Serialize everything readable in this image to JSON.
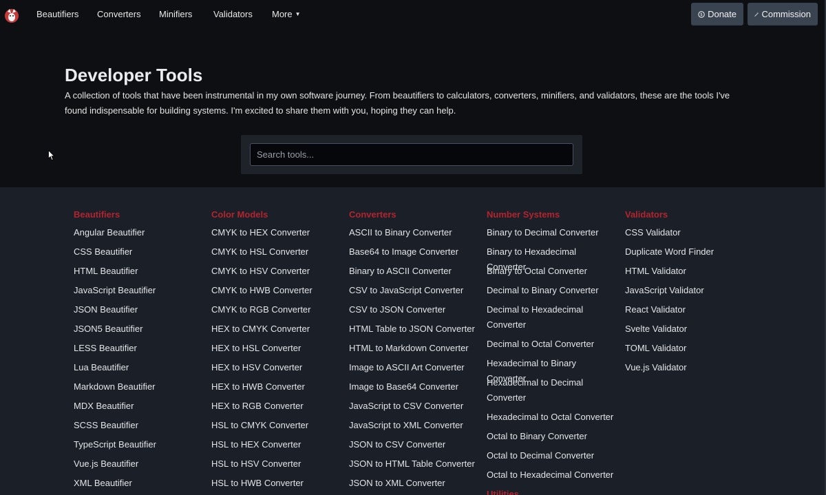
{
  "nav": {
    "items": [
      "Beautifiers",
      "Converters",
      "Minifiers",
      "Validators",
      "More"
    ],
    "donate_label": "Donate",
    "commission_label": "Commission",
    "logo_icon": "fox-logo-icon",
    "donate_icon": "coin-icon",
    "commission_icon": "magic-wand-icon"
  },
  "hero": {
    "title": "Developer Tools",
    "description": "A collection of tools that have been instrumental in my own software journey. From beautifiers to calculators, converters, minifiers, and validators, these are the tools I've found indispensable for building systems. I'm excited to share them with you, hoping they can help.",
    "search_placeholder": "Search tools..."
  },
  "colors": {
    "accent": "#b3242f",
    "background": "#1b1f27",
    "header_background": "#0e0f12",
    "button": "#3a4350"
  },
  "categories": [
    {
      "name": "Beautifiers",
      "items": [
        "Angular Beautifier",
        "CSS Beautifier",
        "HTML Beautifier",
        "JavaScript Beautifier",
        "JSON Beautifier",
        "JSON5 Beautifier",
        "LESS Beautifier",
        "Lua Beautifier",
        "Markdown Beautifier",
        "MDX Beautifier",
        "SCSS Beautifier",
        "TypeScript Beautifier",
        "Vue.js Beautifier",
        "XML Beautifier"
      ]
    },
    {
      "name": "Color Models",
      "items": [
        "CMYK to HEX Converter",
        "CMYK to HSL Converter",
        "CMYK to HSV Converter",
        "CMYK to HWB Converter",
        "CMYK to RGB Converter",
        "HEX to CMYK Converter",
        "HEX to HSL Converter",
        "HEX to HSV Converter",
        "HEX to HWB Converter",
        "HEX to RGB Converter",
        "HSL to CMYK Converter",
        "HSL to HEX Converter",
        "HSL to HSV Converter",
        "HSL to HWB Converter"
      ]
    },
    {
      "name": "Converters",
      "items": [
        "ASCII to Binary Converter",
        "Base64 to Image Converter",
        "Binary to ASCII Converter",
        "CSV to JavaScript Converter",
        "CSV to JSON Converter",
        "HTML Table to JSON Converter",
        "HTML to Markdown Converter",
        "Image to ASCII Art Converter",
        "Image to Base64 Converter",
        "JavaScript to CSV Converter",
        "JavaScript to XML Converter",
        "JSON to CSV Converter",
        "JSON to HTML Table Converter",
        "JSON to XML Converter"
      ]
    },
    {
      "name": "Number Systems",
      "items": [
        "Binary to Decimal Converter",
        "Binary to Hexadecimal Converter",
        "Binary to Octal Converter",
        "Decimal to Binary Converter",
        "Decimal to Hexadecimal Converter",
        "Decimal to Octal Converter",
        "Hexadecimal to Binary Converter",
        "Hexadecimal to Decimal Converter",
        "Hexadecimal to Octal Converter",
        "Octal to Binary Converter",
        "Octal to Decimal Converter",
        "Octal to Hexadecimal Converter"
      ],
      "next_heading": "Utilities"
    },
    {
      "name": "Validators",
      "items": [
        "CSS Validator",
        "Duplicate Word Finder",
        "HTML Validator",
        "JavaScript Validator",
        "React Validator",
        "Svelte Validator",
        "TOML Validator",
        "Vue.js Validator"
      ]
    }
  ]
}
